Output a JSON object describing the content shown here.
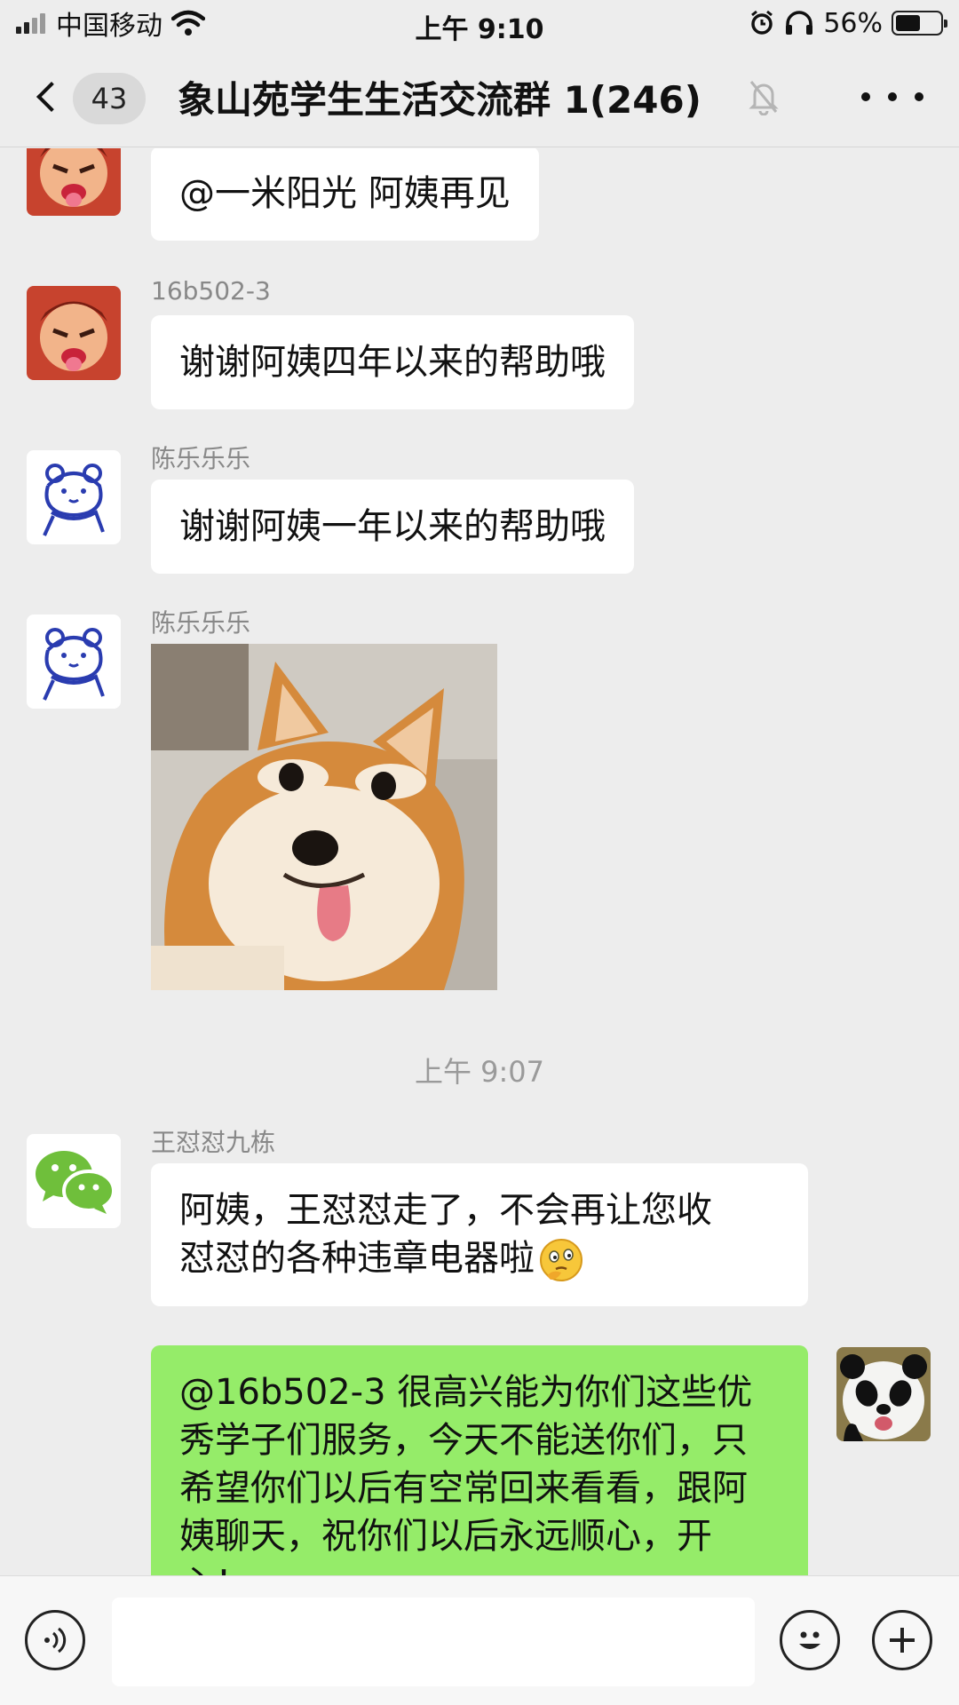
{
  "status_bar": {
    "carrier": "中国移动",
    "time": "上午 9:10",
    "battery_percent": "56%",
    "battery_level": 0.56,
    "icons": [
      "signal-icon",
      "wifi-icon",
      "alarm-icon",
      "headphones-icon",
      "battery-icon"
    ]
  },
  "nav": {
    "unread_count": "43",
    "title": "象山苑学生生活交流群 1(246)",
    "icons": [
      "back-arrow-icon",
      "mute-bell-icon",
      "more-dots-icon"
    ]
  },
  "messages": [
    {
      "sender": "",
      "text": "@一米阳光 阿姨再见",
      "avatar": "red-cartoon-avatar"
    },
    {
      "sender": "16b502-3",
      "text": "谢谢阿姨四年以来的帮助哦",
      "avatar": "red-cartoon-avatar"
    },
    {
      "sender": "陈乐乐乐",
      "text": "谢谢阿姨一年以来的帮助哦",
      "avatar": "blue-bear-avatar"
    },
    {
      "sender": "陈乐乐乐",
      "text": "",
      "image": "shiba-dog-sticker",
      "avatar": "blue-bear-avatar"
    },
    {
      "sender": "王怼怼九栋",
      "text_line1": "阿姨，王怼怼走了，不会再让您收",
      "text_line2": "怼怼的各种违章电器啦",
      "emoji": "thinking-face-emoji",
      "avatar": "wechat-logo-avatar"
    },
    {
      "sender": "me",
      "text": "@16b502-3 很高兴能为你们这些优秀学子们服务，今天不能送你们，只希望你们以后有空常回来看看，跟阿姨聊天，祝你们以后永远顺心，开心！",
      "avatar": "panda-avatar"
    }
  ],
  "timestamp": "上午 9:07",
  "input_bar": {
    "text": "",
    "icons": [
      "voice-icon",
      "emoji-icon",
      "plus-icon"
    ]
  }
}
